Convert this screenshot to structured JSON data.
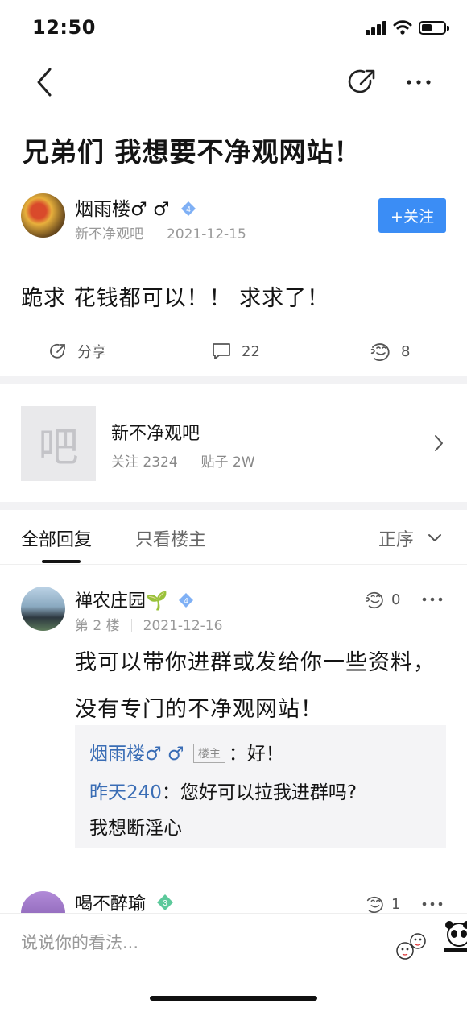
{
  "status": {
    "time": "12:50"
  },
  "post": {
    "title": "兄弟们 我想要不净观网站！",
    "author": {
      "name": "烟雨楼♂ ♂",
      "level_badge": "4",
      "forum": "新不净观吧",
      "date": "2021-12-15"
    },
    "follow_label": "+关注",
    "body": "跪求 花钱都可以！！ 求求了！",
    "actions": {
      "share_label": "分享",
      "comment_count": "22",
      "like_count": "8"
    }
  },
  "forum": {
    "icon_char": "吧",
    "name": "新不净观吧",
    "followers": "关注 2324",
    "posts": "贴子 2W"
  },
  "tabs": {
    "all": "全部回复",
    "owner_only": "只看楼主",
    "sort": "正序"
  },
  "replies": [
    {
      "name": "禅农庄园🌱",
      "level_badge": "4",
      "floor": "第 2 楼",
      "date": "2021-12-16",
      "likes": "0",
      "text": "我可以带你进群或发给你一些资料，没有专门的不净观网站！",
      "sub_replies": [
        {
          "user": "烟雨楼♂ ♂",
          "tag": "楼主",
          "text": "：好！"
        },
        {
          "user": "昨天240",
          "text": "：您好可以拉我进群吗?"
        },
        {
          "text": "我想断淫心"
        }
      ]
    },
    {
      "name": "喝不醉瑜",
      "level_badge": "3",
      "likes": "1"
    }
  ],
  "comment_bar": {
    "placeholder": "说说你的看法..."
  },
  "colors": {
    "accent": "#3b8df5",
    "link": "#3a6db5",
    "band": "#f2f2f4"
  }
}
